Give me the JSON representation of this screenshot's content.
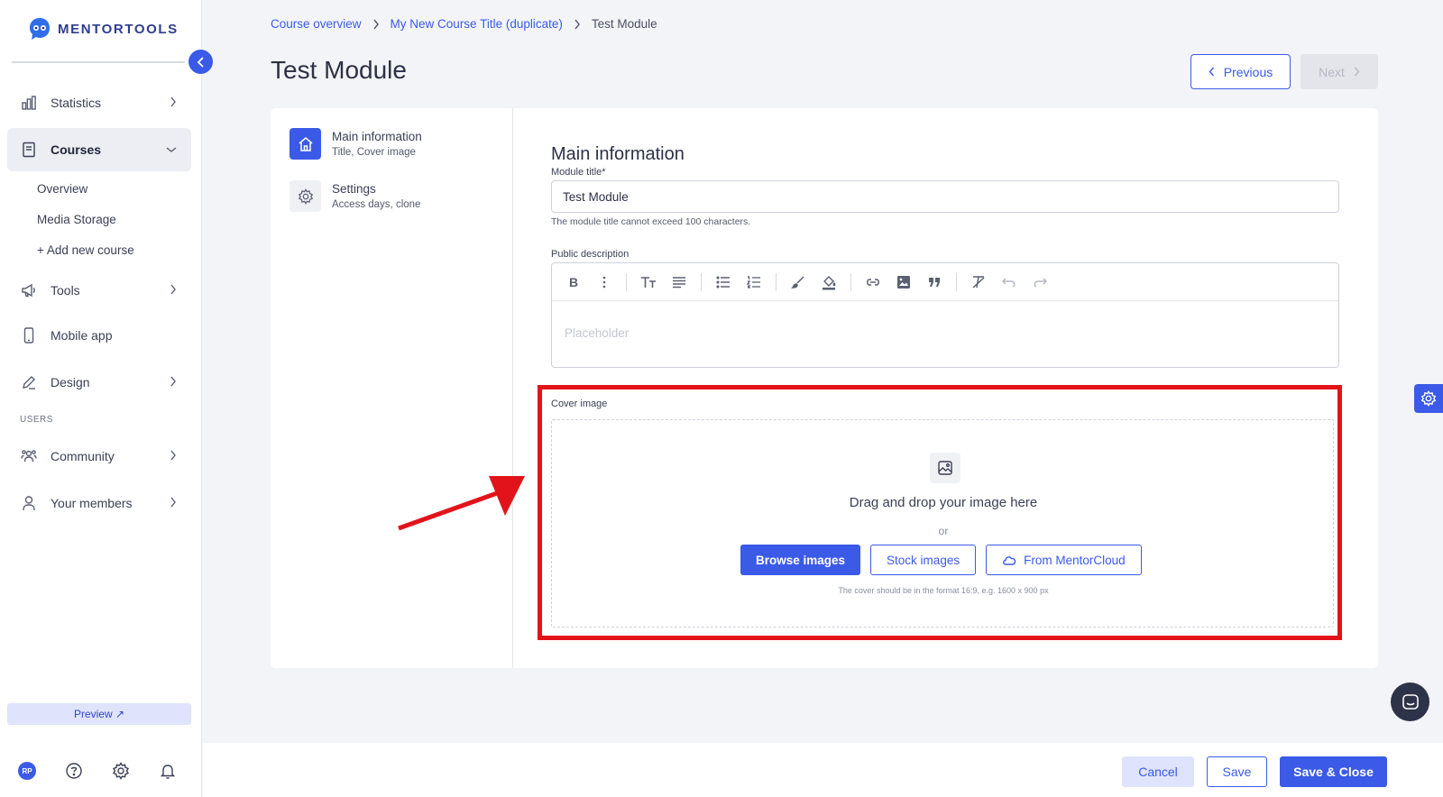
{
  "app": {
    "logo_text": "MENTORTOOLS"
  },
  "sidebar": {
    "items": [
      {
        "label": "Statistics",
        "icon": "bar-chart-icon"
      },
      {
        "label": "Courses",
        "icon": "book-icon",
        "expanded": true
      },
      {
        "label": "Tools",
        "icon": "megaphone-icon"
      },
      {
        "label": "Mobile app",
        "icon": "smartphone-icon"
      },
      {
        "label": "Design",
        "icon": "pencil-icon"
      },
      {
        "label": "Community",
        "icon": "users-icon"
      },
      {
        "label": "Your members",
        "icon": "user-icon"
      }
    ],
    "course_subitems": [
      "Overview",
      "Media Storage",
      "+ Add new course"
    ],
    "section_users": "USERS",
    "preview_label": "Preview ↗",
    "avatar_initials": "RP"
  },
  "breadcrumb": {
    "items": [
      "Course overview",
      "My New Course Title (duplicate)",
      "Test Module"
    ]
  },
  "page": {
    "title": "Test Module",
    "previous_label": "Previous",
    "next_label": "Next"
  },
  "steps": [
    {
      "title": "Main information",
      "subtitle": "Title, Cover image",
      "active": true
    },
    {
      "title": "Settings",
      "subtitle": "Access days, clone",
      "active": false
    }
  ],
  "form": {
    "heading": "Main information",
    "module_title_label": "Module title*",
    "module_title_value": "Test Module",
    "module_title_hint": "The module title cannot exceed 100 characters.",
    "description_label": "Public description",
    "description_placeholder": "Placeholder",
    "cover_label": "Cover image",
    "dropzone_title": "Drag and drop your image here",
    "dropzone_or": "or",
    "browse_label": "Browse images",
    "stock_label": "Stock images",
    "cloud_label": "From MentorCloud",
    "cover_note": "The cover should be in the format 16:9, e.g. 1600 x 900 px"
  },
  "footer": {
    "cancel_label": "Cancel",
    "save_label": "Save",
    "save_close_label": "Save & Close"
  },
  "colors": {
    "accent": "#3b5ae8",
    "highlight": "#e3131b"
  }
}
